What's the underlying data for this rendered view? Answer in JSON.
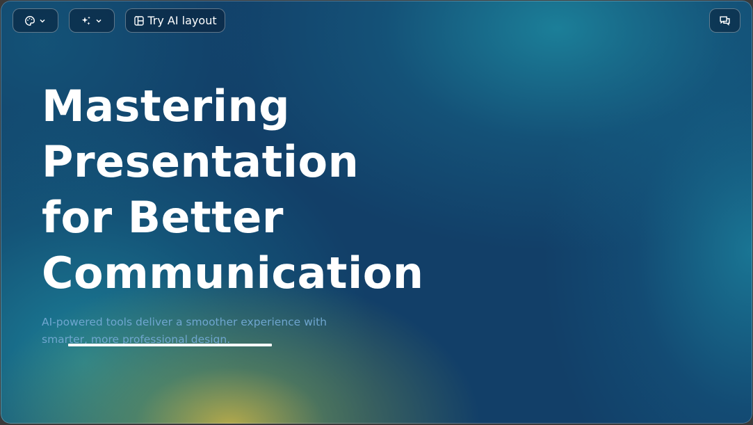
{
  "toolbar": {
    "theme_icon": "palette-icon",
    "ai_icon": "sparkles-icon",
    "layout_icon": "layout-icon",
    "layout_label": "Try AI layout",
    "comment_icon": "comment-icon",
    "dropdown_icon": "chevron-down-icon"
  },
  "slide": {
    "title_lines": [
      "Mastering",
      "Presentation",
      "for Better",
      "Communication"
    ],
    "subtitle": "AI-powered tools deliver a smoother experience with smarter, more professional design."
  },
  "colors": {
    "background_base": "#123f68",
    "accent_teal": "#1c8299",
    "accent_gold": "#c4b246",
    "subtitle_text": "#6fa6cf",
    "title_text": "#ffffff"
  }
}
